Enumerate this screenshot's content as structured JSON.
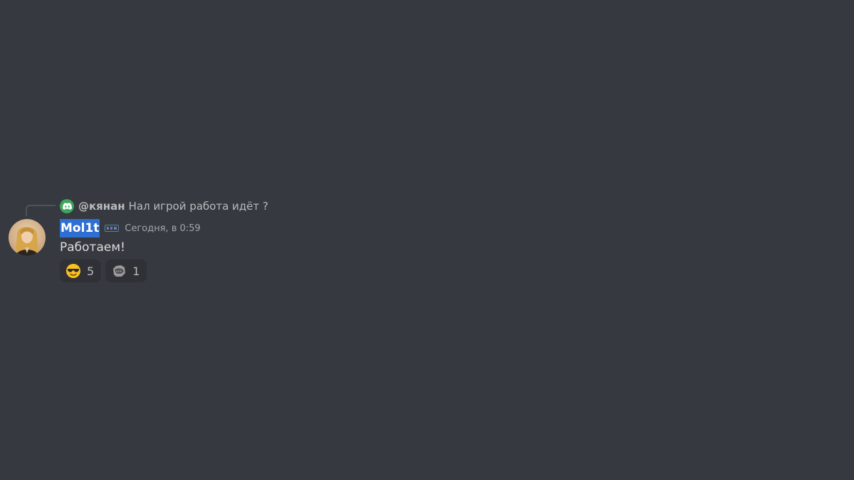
{
  "reply": {
    "author": "@кянан",
    "text": "Нал игрой работа идёт ?",
    "avatar_icon": "discord-logo-icon",
    "avatar_color": "#3ba55c"
  },
  "message": {
    "username": "Mol1t",
    "badge_icon": "server-tag-icon",
    "timestamp": "Сегодня, в 0:59",
    "content": "Работаем!",
    "avatar_icon": "user-avatar"
  },
  "reactions": [
    {
      "emoji_icon": "sunglasses-emoji-icon",
      "count": "5"
    },
    {
      "emoji_icon": "custom-emoji-icon",
      "count": "1"
    }
  ],
  "colors": {
    "background": "#36393f",
    "username_highlight": "#2f6fd1",
    "reaction_bg": "#2f3136"
  }
}
